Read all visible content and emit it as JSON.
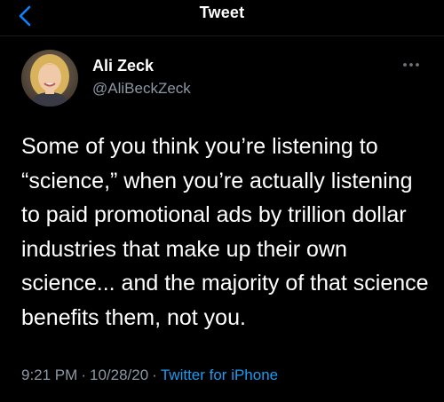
{
  "header": {
    "title": "Tweet",
    "back_icon": "chevron-left-icon",
    "accent_color": "#0a84ff"
  },
  "tweet": {
    "author": {
      "display_name": "Ali Zeck",
      "handle": "@AliBeckZeck"
    },
    "more_icon": "more-horizontal-icon",
    "text": "Some of you think you’re listening to “science,” when you’re actually listening to paid promotional ads by trillion dollar industries that make up their own science... and the majority of that science benefits them, not you.",
    "time": "9:21 PM",
    "separator": "·",
    "date": "10/28/20",
    "source": "Twitter for iPhone",
    "link_color": "#1d9bf0"
  }
}
